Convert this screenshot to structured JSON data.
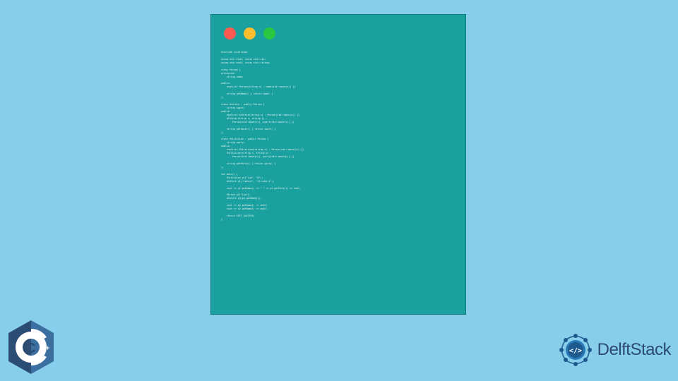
{
  "code": {
    "content": "#include <iostream>\n\nusing std::cout; using std::cin;\nusing std::endl; using std::string;\n\nclass Person {\nprotected:\n    string name;\n\npublic:\n    explicit Person(string n) : name(std::move(n)) {}\n\n    string getName() { return name; }\n};\n\nclass Athlete : public Person {\n    string sport;\npublic:\n    explicit Athlete(string n) : Person(std::move(n)) {}\n    Athlete(string n, string s) :\n        Person(std::move(n)), sport(std::move(s)) {}\n\n    string getSport() { return sport; }\n};\n\nclass Politician : public Person {\n    string party;\npublic:\n    explicit Politician(string n) : Person(std::move(n)) {}\n    Politician(string n, string p) :\n        Person(std::move(n)), party(std::move(p)) {}\n\n    string getParty() { return party; }\n};\n\nint main() {\n    Politician p1(\"Lua\", \"D\");\n    Athlete a1(\"Lebron\", \"LA Lakers\");\n\n    cout << p1.getName() << \" \" << p1.getParty() << endl;\n\n    Person p2(\"Lua\");\n    Athlete a2(p2.getName());\n\n    cout << p2.getName() << endl;\n    cout << a2.getName() << endl;\n\n    return EXIT_SUCCESS;\n}"
  },
  "branding": {
    "cpp_label": "C++",
    "delftstack_label": "DelftStack"
  }
}
